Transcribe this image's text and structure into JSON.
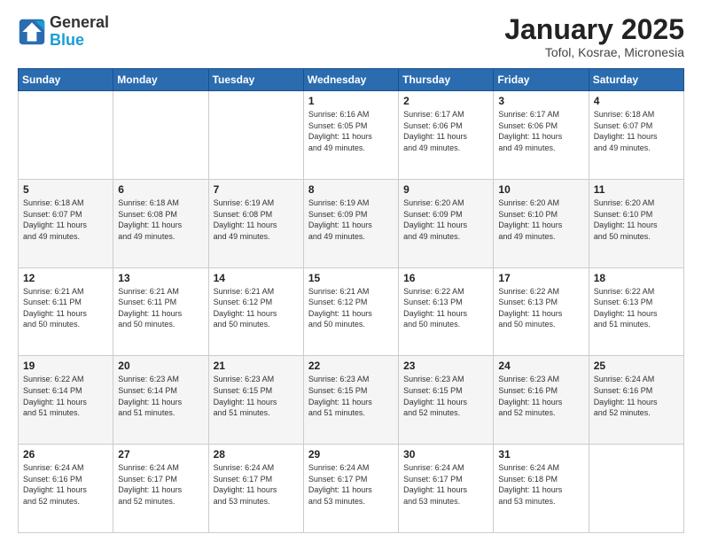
{
  "logo": {
    "line1": "General",
    "line2": "Blue"
  },
  "title": "January 2025",
  "subtitle": "Tofol, Kosrae, Micronesia",
  "days_header": [
    "Sunday",
    "Monday",
    "Tuesday",
    "Wednesday",
    "Thursday",
    "Friday",
    "Saturday"
  ],
  "weeks": [
    [
      {
        "day": "",
        "info": ""
      },
      {
        "day": "",
        "info": ""
      },
      {
        "day": "",
        "info": ""
      },
      {
        "day": "1",
        "info": "Sunrise: 6:16 AM\nSunset: 6:05 PM\nDaylight: 11 hours\nand 49 minutes."
      },
      {
        "day": "2",
        "info": "Sunrise: 6:17 AM\nSunset: 6:06 PM\nDaylight: 11 hours\nand 49 minutes."
      },
      {
        "day": "3",
        "info": "Sunrise: 6:17 AM\nSunset: 6:06 PM\nDaylight: 11 hours\nand 49 minutes."
      },
      {
        "day": "4",
        "info": "Sunrise: 6:18 AM\nSunset: 6:07 PM\nDaylight: 11 hours\nand 49 minutes."
      }
    ],
    [
      {
        "day": "5",
        "info": "Sunrise: 6:18 AM\nSunset: 6:07 PM\nDaylight: 11 hours\nand 49 minutes."
      },
      {
        "day": "6",
        "info": "Sunrise: 6:18 AM\nSunset: 6:08 PM\nDaylight: 11 hours\nand 49 minutes."
      },
      {
        "day": "7",
        "info": "Sunrise: 6:19 AM\nSunset: 6:08 PM\nDaylight: 11 hours\nand 49 minutes."
      },
      {
        "day": "8",
        "info": "Sunrise: 6:19 AM\nSunset: 6:09 PM\nDaylight: 11 hours\nand 49 minutes."
      },
      {
        "day": "9",
        "info": "Sunrise: 6:20 AM\nSunset: 6:09 PM\nDaylight: 11 hours\nand 49 minutes."
      },
      {
        "day": "10",
        "info": "Sunrise: 6:20 AM\nSunset: 6:10 PM\nDaylight: 11 hours\nand 49 minutes."
      },
      {
        "day": "11",
        "info": "Sunrise: 6:20 AM\nSunset: 6:10 PM\nDaylight: 11 hours\nand 50 minutes."
      }
    ],
    [
      {
        "day": "12",
        "info": "Sunrise: 6:21 AM\nSunset: 6:11 PM\nDaylight: 11 hours\nand 50 minutes."
      },
      {
        "day": "13",
        "info": "Sunrise: 6:21 AM\nSunset: 6:11 PM\nDaylight: 11 hours\nand 50 minutes."
      },
      {
        "day": "14",
        "info": "Sunrise: 6:21 AM\nSunset: 6:12 PM\nDaylight: 11 hours\nand 50 minutes."
      },
      {
        "day": "15",
        "info": "Sunrise: 6:21 AM\nSunset: 6:12 PM\nDaylight: 11 hours\nand 50 minutes."
      },
      {
        "day": "16",
        "info": "Sunrise: 6:22 AM\nSunset: 6:13 PM\nDaylight: 11 hours\nand 50 minutes."
      },
      {
        "day": "17",
        "info": "Sunrise: 6:22 AM\nSunset: 6:13 PM\nDaylight: 11 hours\nand 50 minutes."
      },
      {
        "day": "18",
        "info": "Sunrise: 6:22 AM\nSunset: 6:13 PM\nDaylight: 11 hours\nand 51 minutes."
      }
    ],
    [
      {
        "day": "19",
        "info": "Sunrise: 6:22 AM\nSunset: 6:14 PM\nDaylight: 11 hours\nand 51 minutes."
      },
      {
        "day": "20",
        "info": "Sunrise: 6:23 AM\nSunset: 6:14 PM\nDaylight: 11 hours\nand 51 minutes."
      },
      {
        "day": "21",
        "info": "Sunrise: 6:23 AM\nSunset: 6:15 PM\nDaylight: 11 hours\nand 51 minutes."
      },
      {
        "day": "22",
        "info": "Sunrise: 6:23 AM\nSunset: 6:15 PM\nDaylight: 11 hours\nand 51 minutes."
      },
      {
        "day": "23",
        "info": "Sunrise: 6:23 AM\nSunset: 6:15 PM\nDaylight: 11 hours\nand 52 minutes."
      },
      {
        "day": "24",
        "info": "Sunrise: 6:23 AM\nSunset: 6:16 PM\nDaylight: 11 hours\nand 52 minutes."
      },
      {
        "day": "25",
        "info": "Sunrise: 6:24 AM\nSunset: 6:16 PM\nDaylight: 11 hours\nand 52 minutes."
      }
    ],
    [
      {
        "day": "26",
        "info": "Sunrise: 6:24 AM\nSunset: 6:16 PM\nDaylight: 11 hours\nand 52 minutes."
      },
      {
        "day": "27",
        "info": "Sunrise: 6:24 AM\nSunset: 6:17 PM\nDaylight: 11 hours\nand 52 minutes."
      },
      {
        "day": "28",
        "info": "Sunrise: 6:24 AM\nSunset: 6:17 PM\nDaylight: 11 hours\nand 53 minutes."
      },
      {
        "day": "29",
        "info": "Sunrise: 6:24 AM\nSunset: 6:17 PM\nDaylight: 11 hours\nand 53 minutes."
      },
      {
        "day": "30",
        "info": "Sunrise: 6:24 AM\nSunset: 6:17 PM\nDaylight: 11 hours\nand 53 minutes."
      },
      {
        "day": "31",
        "info": "Sunrise: 6:24 AM\nSunset: 6:18 PM\nDaylight: 11 hours\nand 53 minutes."
      },
      {
        "day": "",
        "info": ""
      }
    ]
  ]
}
